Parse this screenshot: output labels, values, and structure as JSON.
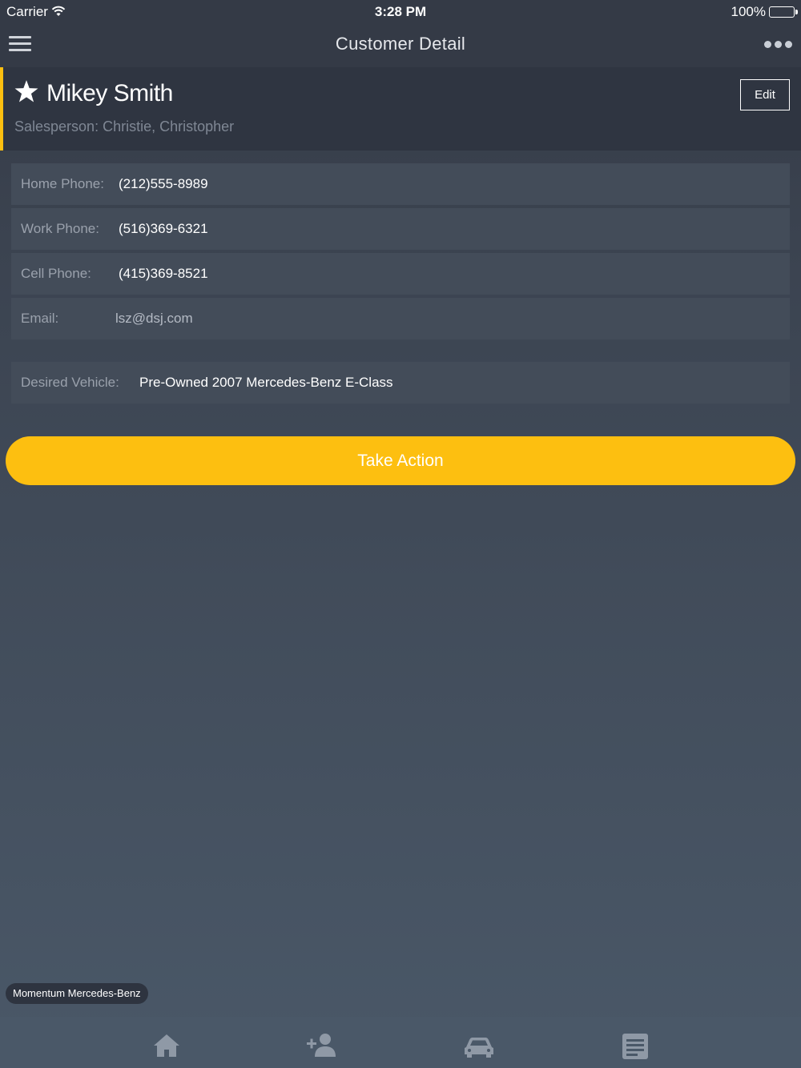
{
  "status_bar": {
    "carrier": "Carrier",
    "time": "3:28 PM",
    "battery": "100%"
  },
  "nav": {
    "title": "Customer Detail",
    "menu_icon": "hamburger-icon",
    "more_icon": "more-dots-icon"
  },
  "customer": {
    "name": "Mikey Smith",
    "salesperson": "Salesperson: Christie, Christopher",
    "edit_label": "Edit",
    "starred": true
  },
  "contact": {
    "home_phone_label": "Home Phone:",
    "home_phone": "(212)555-8989",
    "work_phone_label": "Work Phone:",
    "work_phone": "(516)369-6321",
    "cell_phone_label": "Cell Phone:",
    "cell_phone": "(415)369-8521",
    "email_label": "Email:",
    "email": "lsz@dsj.com"
  },
  "vehicle": {
    "label": "Desired Vehicle:",
    "value": "Pre-Owned 2007 Mercedes-Benz E-Class"
  },
  "actions": {
    "take_action_label": "Take Action"
  },
  "dealer": {
    "name": "Momentum Mercedes-Benz"
  },
  "tabs": [
    {
      "icon": "home-icon"
    },
    {
      "icon": "add-person-icon"
    },
    {
      "icon": "car-icon"
    },
    {
      "icon": "document-icon"
    }
  ],
  "colors": {
    "accent": "#fdbf10",
    "header_bg": "#343a46",
    "row_bg": "#434c59"
  }
}
